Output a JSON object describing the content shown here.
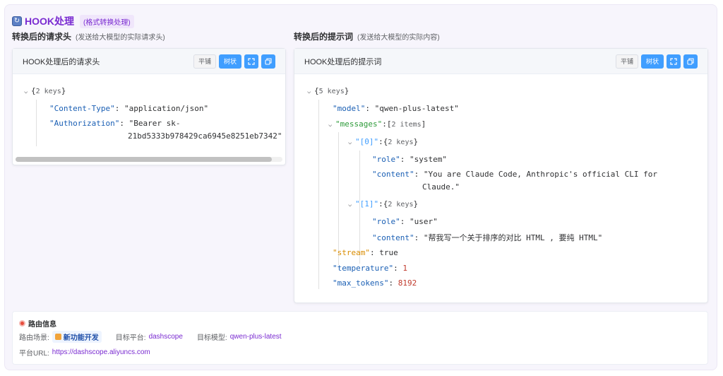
{
  "header": {
    "title": "HOOK处理",
    "badge": "(格式转换处理)"
  },
  "left": {
    "section_label": "转换后的请求头",
    "section_sub": "(发送给大模型的实际请求头)",
    "panel_title": "HOOK处理后的请求头",
    "buttons": {
      "flat": "平铺",
      "tree": "树状"
    },
    "json": {
      "root_meta": "2 keys",
      "k1": "\"Content-Type\"",
      "v1": "\"application/json\"",
      "k2": "\"Authorization\"",
      "v2a": "\"Bearer sk-",
      "v2b": "21bd5333b978429ca6945e8251eb7342\""
    }
  },
  "right": {
    "section_label": "转换后的提示词",
    "section_sub": "(发送给大模型的实际内容)",
    "panel_title": "HOOK处理后的提示词",
    "buttons": {
      "flat": "平铺",
      "tree": "树状"
    },
    "json": {
      "root_meta": "5 keys",
      "model_k": "\"model\"",
      "model_v": "\"qwen-plus-latest\"",
      "messages_k": "\"messages\"",
      "messages_meta": "2 items",
      "i0": "\"[0]\"",
      "i0_meta": "2 keys",
      "role_k": "\"role\"",
      "role0_v": "\"system\"",
      "content_k": "\"content\"",
      "content0_a": "\"You are Claude Code, Anthropic's official CLI for",
      "content0_b": "Claude.\"",
      "i1": "\"[1]\"",
      "i1_meta": "2 keys",
      "role1_v": "\"user\"",
      "content1_v": "\"帮我写一个关于排序的对比 HTML , 要纯 HTML\"",
      "stream_k": "\"stream\"",
      "stream_v": "true",
      "temp_k": "\"temperature\"",
      "temp_v": "1",
      "max_k": "\"max_tokens\"",
      "max_v": "8192"
    }
  },
  "route": {
    "title": "路由信息",
    "scene_label": "路由场景:",
    "scene_value": "新功能开发",
    "platform_label": "目标平台:",
    "platform_value": "dashscope",
    "model_label": "目标模型:",
    "model_value": "qwen-plus-latest",
    "url_label": "平台URL:",
    "url_value": "https://dashscope.aliyuncs.com"
  },
  "colors": {
    "accent": "#7a2bd1",
    "primary": "#409eff"
  }
}
